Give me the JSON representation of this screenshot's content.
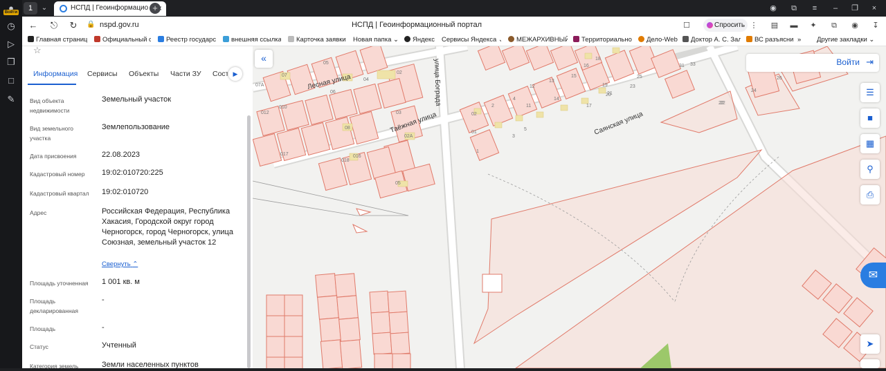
{
  "browser": {
    "tab_count": "1",
    "tab_title": "НСПД | Геоинформацио",
    "url": "nspd.gov.ru",
    "page_title": "НСПД | Геоинформационный портал",
    "ask_label": "Спросить",
    "rail_badge": "Войти"
  },
  "bookmarks": [
    {
      "label": "Главная страниц",
      "color": "#222"
    },
    {
      "label": "Официальный са",
      "color": "#c0392b"
    },
    {
      "label": "Реестр государст",
      "color": "#2a7de1"
    },
    {
      "label": "внешняя ссылка",
      "color": "#3b9ed8"
    },
    {
      "label": "Карточка заявки",
      "color": "#999"
    },
    {
      "label": "Новая папка",
      "color": "#e8b100"
    },
    {
      "label": "Яндекс",
      "color": "#222"
    },
    {
      "label": "Сервисы Яндекса",
      "color": "#e8b100"
    },
    {
      "label": "МЕЖАРХИВНЫЙ",
      "color": "#8a5a2b"
    },
    {
      "label": "Территориально",
      "color": "#8b1c5a"
    },
    {
      "label": "Дело-Web",
      "color": "#e07b00"
    },
    {
      "label": "Доктор А. С. Зал",
      "color": "#555"
    },
    {
      "label": "ВС разъясни",
      "color": "#e07b00"
    },
    {
      "label": "Другие закладки",
      "color": "#e8b100"
    }
  ],
  "panel": {
    "tabs": [
      "Информация",
      "Сервисы",
      "Объекты",
      "Части ЗУ",
      "Соста"
    ],
    "fields": [
      {
        "label": "Вид объекта недвижимости",
        "value": "Земельный участок"
      },
      {
        "label": "Вид земельного участка",
        "value": "Землепользование"
      },
      {
        "label": "Дата присвоения",
        "value": "22.08.2023"
      },
      {
        "label": "Кадастровый номер",
        "value": "19:02:010720:225"
      },
      {
        "label": "Кадастровый квартал",
        "value": "19:02:010720"
      },
      {
        "label": "Адрес",
        "value": "Российская Федерация, Республика Хакасия, Городской округ город Черногорск, город Черногорск, улица Союзная, земельный участок 12"
      },
      {
        "label": "Площадь уточненная",
        "value": "1 001 кв. м"
      },
      {
        "label": "Площадь декларированная",
        "value": "-"
      },
      {
        "label": "Площадь",
        "value": "-"
      },
      {
        "label": "Статус",
        "value": "Учтенный"
      },
      {
        "label": "Категория земель",
        "value": "Земли населенных пунктов"
      }
    ],
    "collapse_link": "Свернуть"
  },
  "map": {
    "login_label": "Войти",
    "streets": [
      "Лесная улица",
      "Таёжная улица",
      "улица Бограда",
      "Саянская улица"
    ],
    "parcel_numbers": [
      "07А",
      "05",
      "07",
      "02",
      "04",
      "06",
      "012",
      "010",
      "03",
      "08",
      "02А",
      "017",
      "018",
      "016",
      "05",
      "01",
      "02",
      "1",
      "2",
      "3",
      "4",
      "5",
      "24",
      "26",
      "22",
      "23",
      "25",
      "31",
      "33",
      "11",
      "12",
      "13",
      "14",
      "15",
      "16",
      "17",
      "18",
      "19",
      "20",
      "21",
      "22"
    ],
    "accent": "#1a5fd0",
    "parcel_stroke": "#e07a6a",
    "parcel_fill": "#f7dcd6",
    "building_fill": "#efe3a8"
  }
}
